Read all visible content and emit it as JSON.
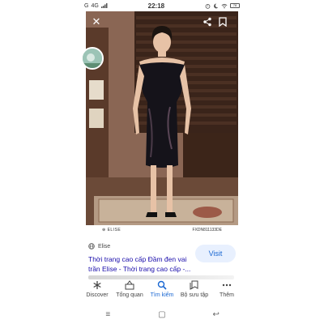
{
  "status_bar": {
    "left_text": "G",
    "network": "4G",
    "time": "22:18",
    "battery": "78"
  },
  "image": {
    "caption_brand": "ELISE",
    "caption_code": "FXDN811133DE"
  },
  "result": {
    "source_name": "Elise",
    "title": "Thời trang cao cấp Đầm đen vai trần Elise - Thời trang cao cấp -...",
    "visit_label": "Visit"
  },
  "bottom_nav": {
    "items": [
      {
        "label": "Discover",
        "icon": "asterisk-icon"
      },
      {
        "label": "Tổng quan",
        "icon": "overview-icon"
      },
      {
        "label": "Tìm kiếm",
        "icon": "search-icon"
      },
      {
        "label": "Bộ sưu tập",
        "icon": "collections-icon"
      },
      {
        "label": "Thêm",
        "icon": "more-icon"
      }
    ],
    "active_index": 2
  },
  "colors": {
    "accent": "#1967d2",
    "link": "#1a0dab",
    "visit_bg": "#e8f0fe"
  }
}
